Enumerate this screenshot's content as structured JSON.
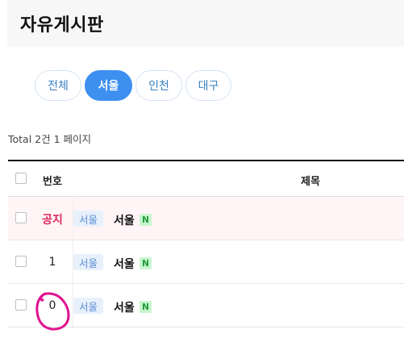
{
  "page": {
    "title": "자유게시판"
  },
  "tabs": [
    {
      "label": "전체",
      "active": false
    },
    {
      "label": "서울",
      "active": true
    },
    {
      "label": "인천",
      "active": false
    },
    {
      "label": "대구",
      "active": false
    }
  ],
  "summary": {
    "total_text": "Total 2건 1 페이지"
  },
  "table": {
    "headers": {
      "number": "번호",
      "title": "제목"
    },
    "rows": [
      {
        "number": "공지",
        "is_notice": true,
        "category": "서울",
        "title": "서울",
        "new_badge": "N"
      },
      {
        "number": "1",
        "is_notice": false,
        "category": "서울",
        "title": "서울",
        "new_badge": "N"
      },
      {
        "number": "0",
        "is_notice": false,
        "category": "서울",
        "title": "서울",
        "new_badge": "N"
      }
    ]
  },
  "colors": {
    "accent": "#3d8ff0",
    "notice": "#e0245e",
    "annotation": "#e0128f"
  }
}
